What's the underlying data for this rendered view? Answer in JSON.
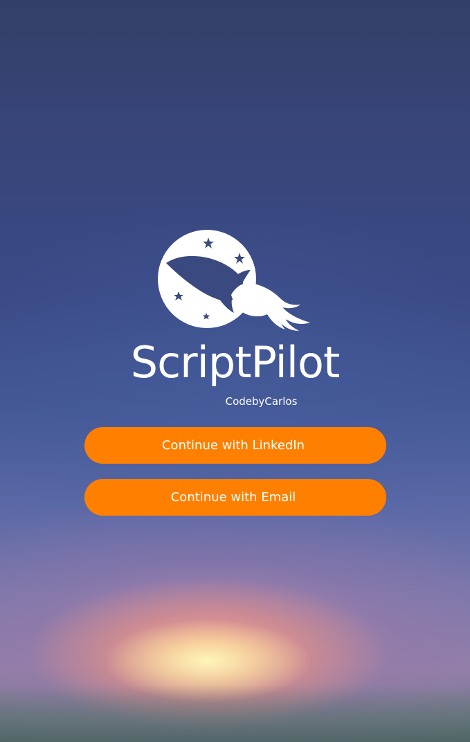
{
  "app": {
    "name": "ScriptPilot",
    "author": "CodebyCarlos"
  },
  "logo": {
    "icon": "rocket-moon-logo-icon"
  },
  "actions": {
    "linkedin_label": "Continue with LinkedIn",
    "email_label": "Continue with Email"
  },
  "colors": {
    "button": "#ff8000",
    "text": "#ffffff",
    "logo_fill": "#ffffff",
    "logo_stars": "#3a4a80"
  }
}
